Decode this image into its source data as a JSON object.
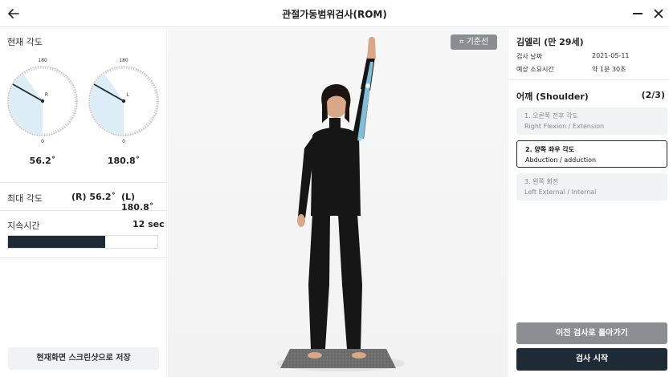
{
  "header": {
    "title": "관절가동범위검사(ROM)"
  },
  "left": {
    "current_angle_title": "현재 각도",
    "gauges": [
      {
        "side_label": "R",
        "top_label": "180",
        "bottom_label": "0",
        "value": "56.2˚",
        "angle": 56.2,
        "needle_angle": 120
      },
      {
        "side_label": "L",
        "top_label": "180",
        "bottom_label": "0",
        "value": "180.8˚",
        "angle": 180.8,
        "needle_angle": 120
      }
    ],
    "max_angle_label": "최대 각도",
    "max_r": "(R) 56.2˚",
    "max_l": "(L) 180.8˚",
    "duration_label": "지속시간",
    "duration_value": "12 sec",
    "duration_progress": 0.65,
    "screenshot_button": "현재화면 스크린샷으로 저장"
  },
  "center": {
    "baseline_button": "⌗ 기준선"
  },
  "right": {
    "patient_name": "김엘리 (만 29세)",
    "exam_date_label": "검사 날짜",
    "exam_date_value": "2021-05-11",
    "duration_label": "예상 소요시간",
    "duration_value": "약 1분 30초",
    "section_title": "어깨 (Shoulder)",
    "section_count": "(2/3)",
    "tests": [
      {
        "title": "1. 오른쪽 전후 각도",
        "subtitle": "Right Flexion / Extension",
        "active": false
      },
      {
        "title": "2. 양쪽 좌우 각도",
        "subtitle": "Abduction / adduction",
        "active": true
      },
      {
        "title": "3. 왼쪽 회전",
        "subtitle": "Left External / Internal",
        "active": false
      }
    ],
    "prev_button": "이전 검사로 돌아가기",
    "start_button": "검사 시작"
  },
  "colors": {
    "dark": "#1e2a36",
    "gray_button": "#8b8f94",
    "gauge_fill": "#dcedf6",
    "highlight": "#8fd0ec"
  }
}
